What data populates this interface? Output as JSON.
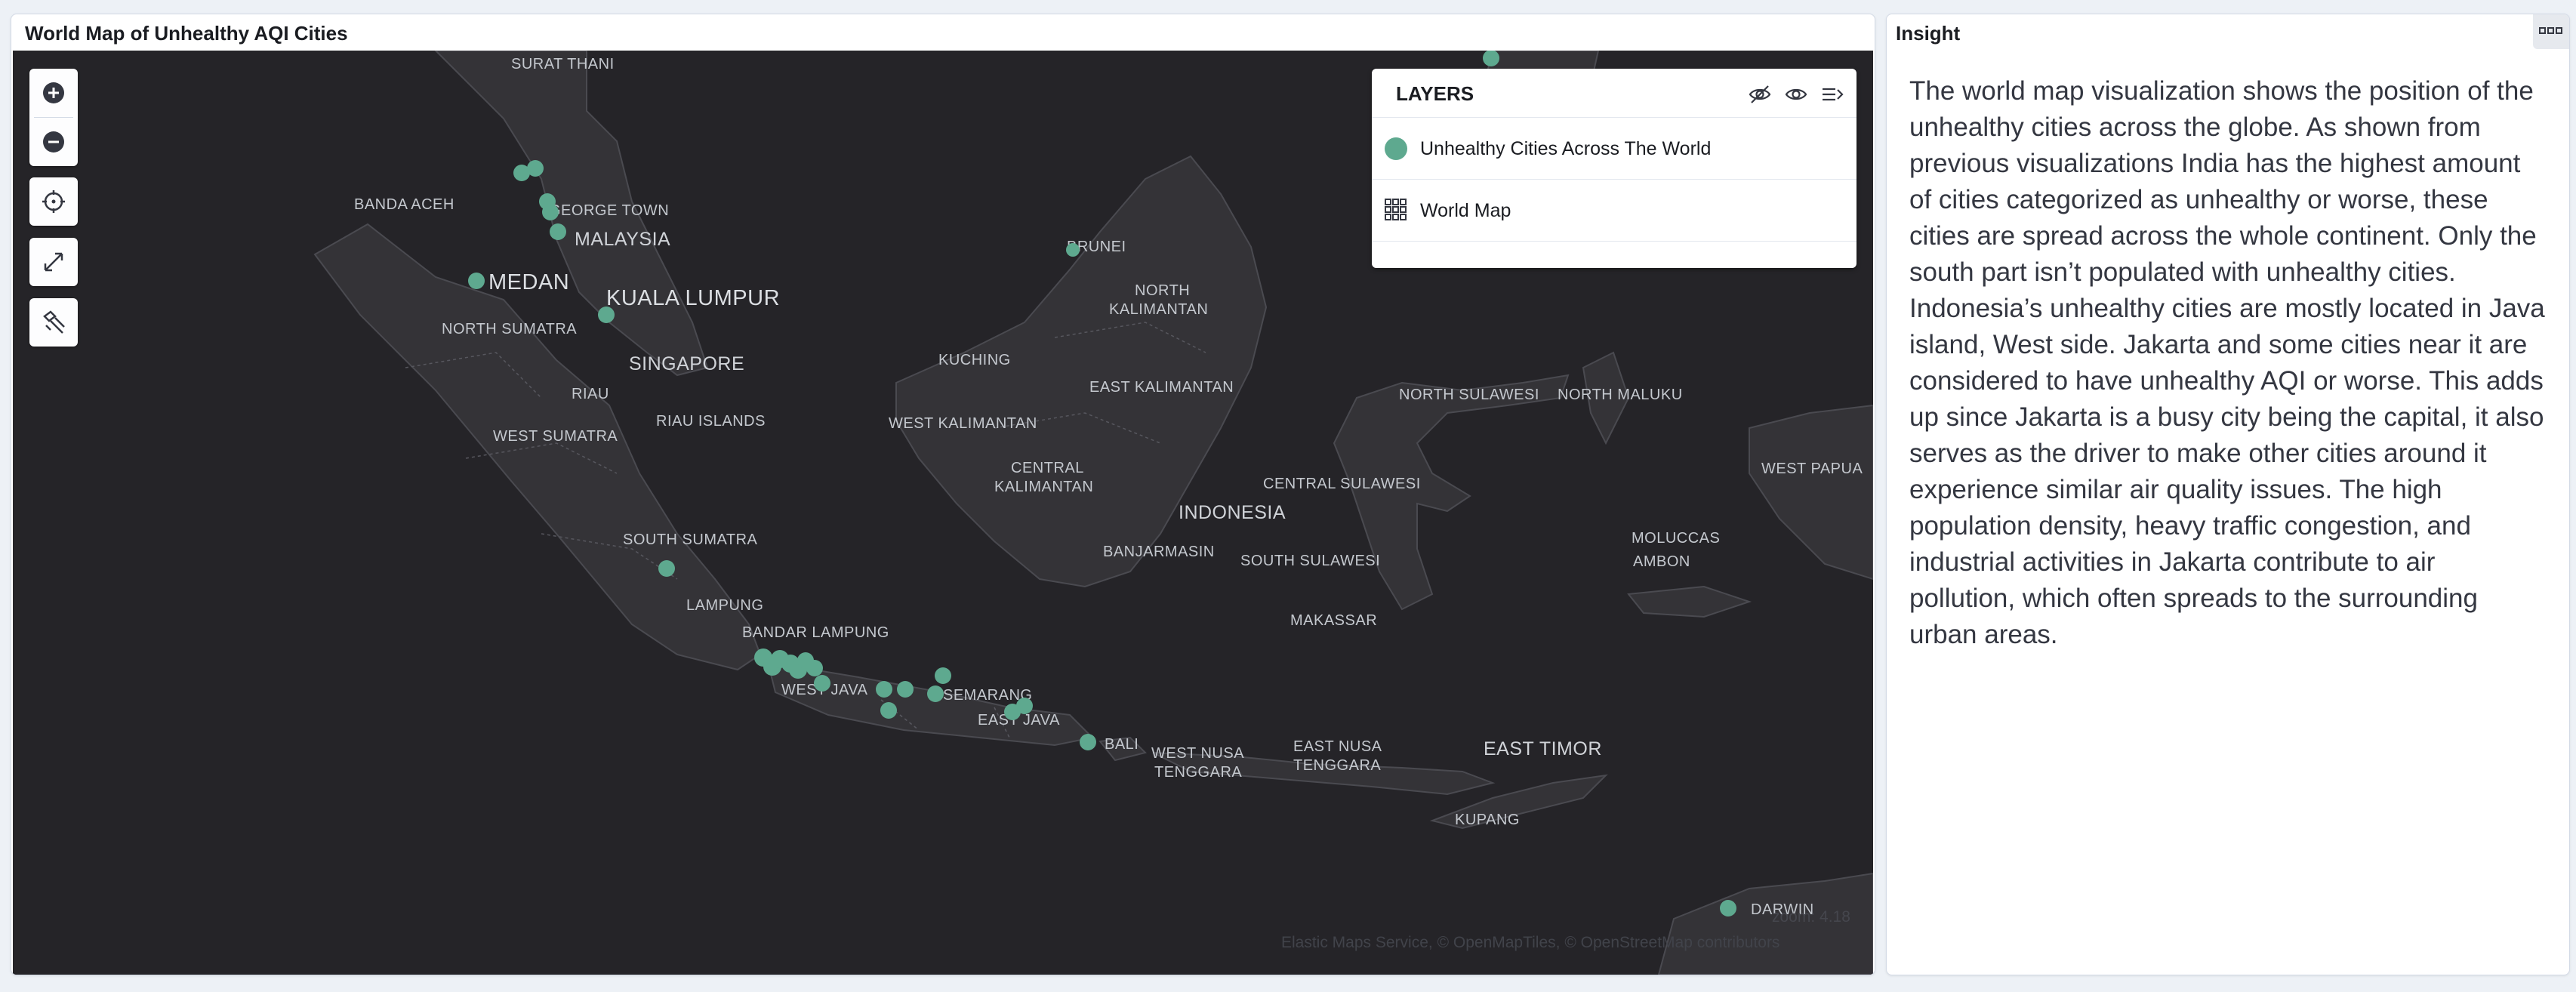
{
  "map_panel": {
    "title": "World Map of Unhealthy AQI Cities"
  },
  "map_controls": {
    "zoom_in_icon": "plus-circle-icon",
    "zoom_out_icon": "minus-circle-icon",
    "locate_icon": "crosshair-icon",
    "fullscreen_icon": "expand-icon",
    "draw_icon": "draw-tool-icon"
  },
  "layers_panel": {
    "title": "LAYERS",
    "hide_all_icon": "eye-closed-icon",
    "show_all_icon": "eye-icon",
    "collapse_icon": "collapse-panel-icon",
    "layers": [
      {
        "label": "Unhealthy Cities Across The World",
        "icon": "circle-point-icon",
        "color": "#5ea98f"
      },
      {
        "label": "World Map",
        "icon": "grid-tiles-icon"
      }
    ]
  },
  "map_labels": {
    "surat_thani": "SURAT THANI",
    "banda_aceh": "BANDA ACEH",
    "george_town": "GEORGE TOWN",
    "malaysia": "MALAYSIA",
    "medan": "MEDAN",
    "kuala_lumpur": "KUALA LUMPUR",
    "north_sumatra": "NORTH SUMATRA",
    "singapore": "SINGAPORE",
    "riau": "RIAU",
    "riau_islands": "RIAU ISLANDS",
    "west_sumatra": "WEST SUMATRA",
    "south_sumatra": "SOUTH SUMATRA",
    "lampung": "LAMPUNG",
    "bandar_lampung": "BANDAR LAMPUNG",
    "west_java": "WEST JAVA",
    "semarang": "SEMARANG",
    "east_java": "EAST JAVA",
    "bali": "BALI",
    "west_nusa_tenggara_1": "WEST NUSA",
    "west_nusa_tenggara_2": "TENGGARA",
    "east_nusa_tenggara_1": "EAST NUSA",
    "east_nusa_tenggara_2": "TENGGARA",
    "east_timor": "EAST TIMOR",
    "kupang": "KUPANG",
    "darwin": "DARWIN",
    "brunei": "BRUNEI",
    "north_kalimantan_1": "NORTH",
    "north_kalimantan_2": "KALIMANTAN",
    "kuching": "KUCHING",
    "east_kalimantan": "EAST KALIMANTAN",
    "west_kalimantan": "WEST KALIMANTAN",
    "central_kalimantan_1": "CENTRAL",
    "central_kalimantan_2": "KALIMANTAN",
    "indonesia": "INDONESIA",
    "banjarmasin": "BANJARMASIN",
    "central_sulawesi": "CENTRAL SULAWESI",
    "south_sulawesi": "SOUTH SULAWESI",
    "makassar": "MAKASSAR",
    "north_sulawesi": "NORTH SULAWESI",
    "north_maluku": "NORTH MALUKU",
    "west_papua": "WEST PAPUA",
    "moluccas": "MOLUCCAS",
    "ambon": "AMBON"
  },
  "map_footer": {
    "zoom_text": "zoom: 4.18",
    "attribution": "Elastic Maps Service, © OpenMapTiles, © OpenStreetMap contributors"
  },
  "insight_panel": {
    "title": "Insight",
    "menu_icon": "ellipsis-icon",
    "text": "The world map visualization shows the position of the unhealthy cities across the globe. As shown from previous visualizations India has the highest amount of cities categorized as unhealthy or worse, these cities are spread across the whole continent. Only the south part isn’t populated with unhealthy cities. Indonesia’s unhealthy cities are mostly located in Java island, West side. Jakarta and some cities near it are considered to have unhealthy AQI or worse. This adds up since Jakarta is a busy city being the capital, it also serves as the driver to make other cities around it experience similar air quality issues. The high population density, heavy traffic congestion, and industrial activities in Jakarta contribute to air pollution, which often spreads to the surrounding urban areas."
  }
}
